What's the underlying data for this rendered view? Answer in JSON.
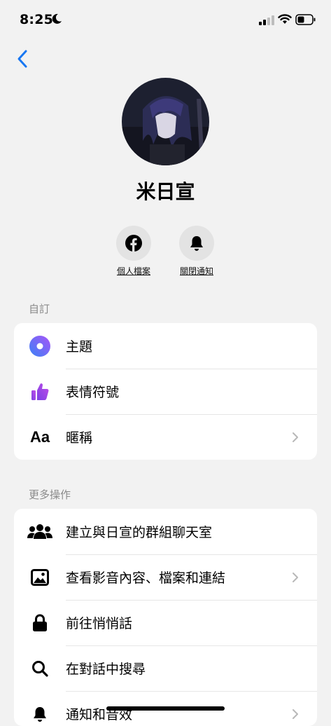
{
  "status": {
    "time": "8:25"
  },
  "profile": {
    "name": "米日宣"
  },
  "actions": [
    {
      "label": "個人檔案",
      "icon": "facebook-icon"
    },
    {
      "label": "關閉通知",
      "icon": "bell-icon"
    }
  ],
  "sections": {
    "customize": {
      "title": "自訂",
      "items": [
        {
          "label": "主題",
          "icon": "theme-icon"
        },
        {
          "label": "表情符號",
          "icon": "thumbs-up-icon"
        },
        {
          "label": "暱稱",
          "icon": "text-aa-icon"
        }
      ]
    },
    "more": {
      "title": "更多操作",
      "items": [
        {
          "label": "建立與日宣的群組聊天室",
          "icon": "group-icon"
        },
        {
          "label": "查看影音內容、檔案和連結",
          "icon": "image-icon"
        },
        {
          "label": "前往悄悄話",
          "icon": "lock-icon"
        },
        {
          "label": "在對話中搜尋",
          "icon": "search-icon"
        },
        {
          "label": "通知和音效",
          "icon": "bell-icon"
        }
      ]
    }
  },
  "colors": {
    "accent_blue": "#1877f2",
    "theme_gradient_start": "#3b82f6",
    "theme_gradient_end": "#a855f7",
    "thumb_purple": "#9b4dee"
  }
}
